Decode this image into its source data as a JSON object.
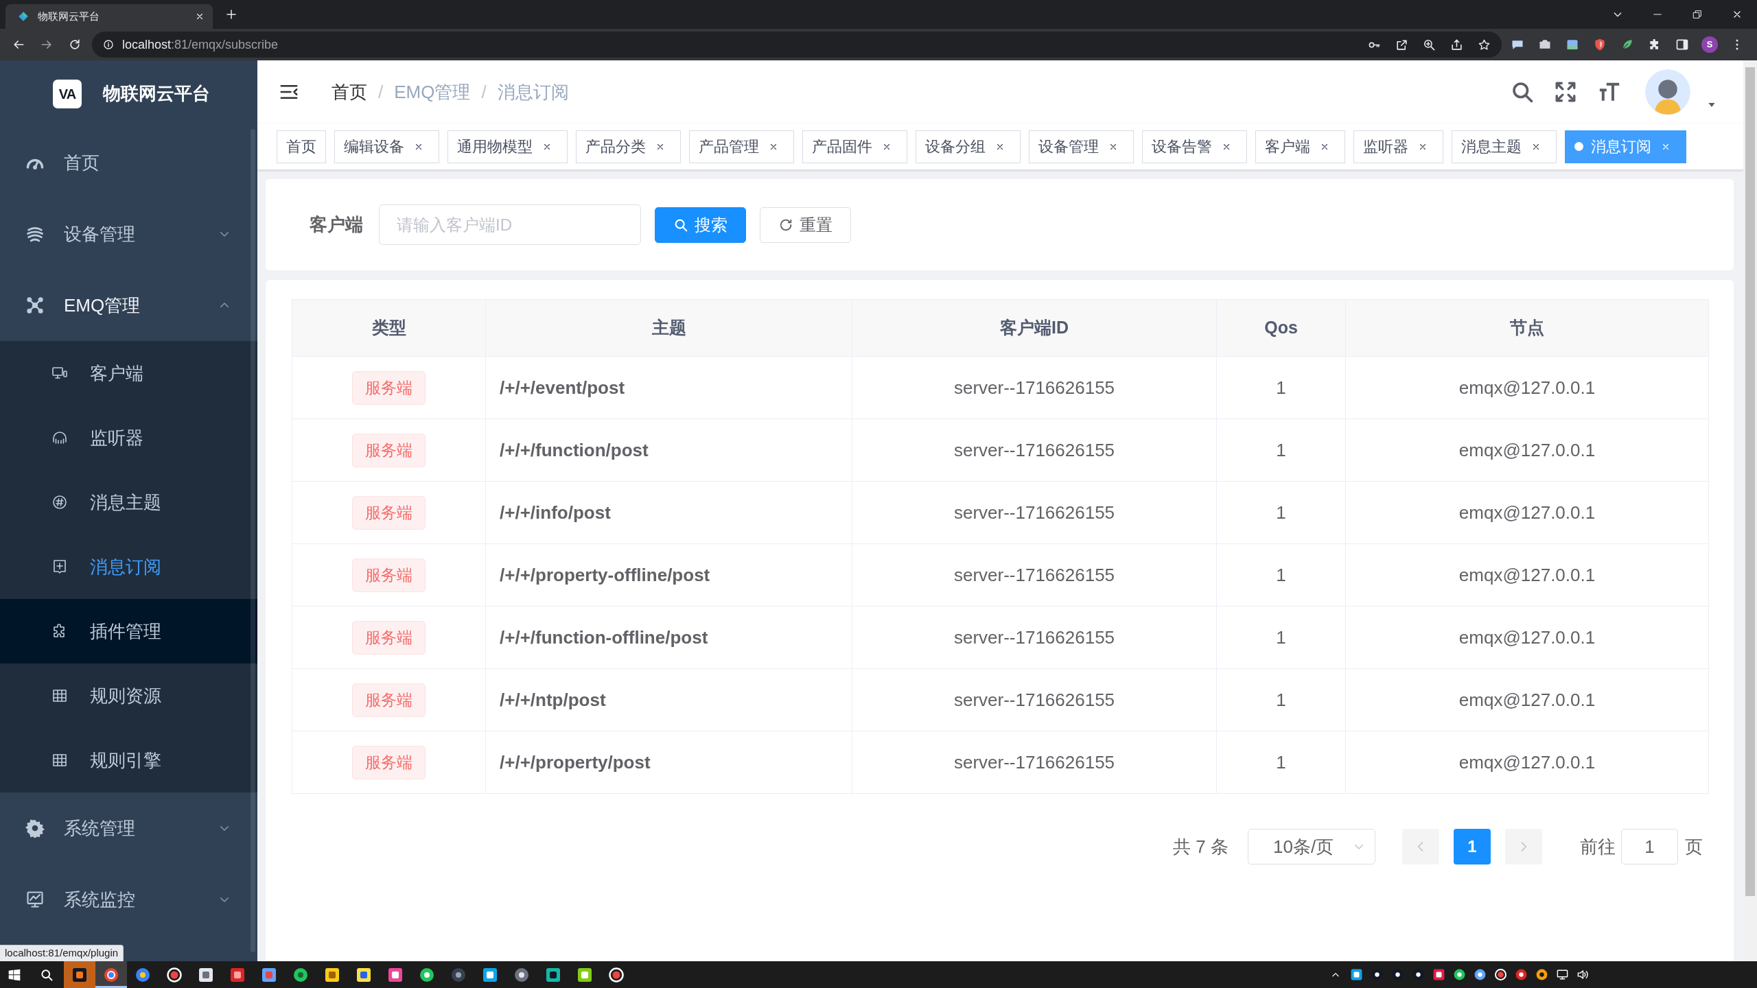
{
  "browser": {
    "tab_title": "物联网云平台",
    "url": {
      "host": "localhost",
      "rest": ":81/emqx/subscribe"
    },
    "profile_initial": "S",
    "status_url": "localhost:81/emqx/plugin"
  },
  "sidebar": {
    "logo_mark": "VA",
    "title": "物联网云平台",
    "items": [
      {
        "label": "首页",
        "kind": "link",
        "selected": false
      },
      {
        "label": "设备管理",
        "kind": "submenu",
        "selected": false,
        "expanded": false
      },
      {
        "label": "EMQ管理",
        "kind": "submenu",
        "selected": false,
        "expanded": true,
        "children": [
          {
            "label": "客户端",
            "selected": false,
            "hovered": false
          },
          {
            "label": "监听器",
            "selected": false,
            "hovered": false
          },
          {
            "label": "消息主题",
            "selected": false,
            "hovered": false
          },
          {
            "label": "消息订阅",
            "selected": true,
            "hovered": false
          },
          {
            "label": "插件管理",
            "selected": false,
            "hovered": true
          },
          {
            "label": "规则资源",
            "selected": false,
            "hovered": false
          },
          {
            "label": "规则引擎",
            "selected": false,
            "hovered": false
          }
        ]
      },
      {
        "label": "系统管理",
        "kind": "submenu",
        "selected": false,
        "expanded": false
      },
      {
        "label": "系统监控",
        "kind": "submenu",
        "selected": false,
        "expanded": false
      }
    ]
  },
  "navbar": {
    "breadcrumb": [
      {
        "label": "首页",
        "link": true
      },
      {
        "separator": "/",
        "label": "EMQ管理",
        "link": false
      },
      {
        "separator": "/",
        "label": "消息订阅",
        "link": false
      }
    ]
  },
  "tags": [
    {
      "label": "首页",
      "closable": false,
      "selected": false
    },
    {
      "label": "编辑设备",
      "closable": true,
      "selected": false
    },
    {
      "label": "通用物模型",
      "closable": true,
      "selected": false
    },
    {
      "label": "产品分类",
      "closable": true,
      "selected": false
    },
    {
      "label": "产品管理",
      "closable": true,
      "selected": false
    },
    {
      "label": "产品固件",
      "closable": true,
      "selected": false
    },
    {
      "label": "设备分组",
      "closable": true,
      "selected": false
    },
    {
      "label": "设备管理",
      "closable": true,
      "selected": false
    },
    {
      "label": "设备告警",
      "closable": true,
      "selected": false
    },
    {
      "label": "客户端",
      "closable": true,
      "selected": false
    },
    {
      "label": "监听器",
      "closable": true,
      "selected": false
    },
    {
      "label": "消息主题",
      "closable": true,
      "selected": false
    },
    {
      "label": "消息订阅",
      "closable": true,
      "selected": true
    }
  ],
  "search": {
    "label": "客户端",
    "placeholder": "请输入客户端ID",
    "buttons": [
      {
        "label": "搜索",
        "kind": "primary"
      },
      {
        "label": "重置",
        "kind": "default"
      }
    ]
  },
  "table": {
    "columns": [
      "类型",
      "主题",
      "客户端ID",
      "Qos",
      "节点"
    ],
    "rows": [
      {
        "type": "服务端",
        "topic": "/+/+/event/post",
        "client_id": "server--1716626155",
        "qos": "1",
        "node": "emqx@127.0.0.1"
      },
      {
        "type": "服务端",
        "topic": "/+/+/function/post",
        "client_id": "server--1716626155",
        "qos": "1",
        "node": "emqx@127.0.0.1"
      },
      {
        "type": "服务端",
        "topic": "/+/+/info/post",
        "client_id": "server--1716626155",
        "qos": "1",
        "node": "emqx@127.0.0.1"
      },
      {
        "type": "服务端",
        "topic": "/+/+/property-offline/post",
        "client_id": "server--1716626155",
        "qos": "1",
        "node": "emqx@127.0.0.1"
      },
      {
        "type": "服务端",
        "topic": "/+/+/function-offline/post",
        "client_id": "server--1716626155",
        "qos": "1",
        "node": "emqx@127.0.0.1"
      },
      {
        "type": "服务端",
        "topic": "/+/+/ntp/post",
        "client_id": "server--1716626155",
        "qos": "1",
        "node": "emqx@127.0.0.1"
      },
      {
        "type": "服务端",
        "topic": "/+/+/property/post",
        "client_id": "server--1716626155",
        "qos": "1",
        "node": "emqx@127.0.0.1"
      }
    ]
  },
  "pagination": {
    "total": "共 7 条",
    "page_size": "10条/页",
    "prev_disabled": true,
    "pages": [
      {
        "label": "1",
        "selected": true
      }
    ],
    "next_disabled": true,
    "goto_label": "前往",
    "goto_value": "1",
    "goto_suffix": "页"
  },
  "taskbar": {
    "apps": [
      {
        "selected": false,
        "attention": true
      },
      {
        "selected": true,
        "attention": false
      },
      {
        "selected": false,
        "attention": false
      },
      {
        "selected": false,
        "attention": false
      },
      {
        "selected": false,
        "attention": false
      },
      {
        "selected": false,
        "attention": false
      },
      {
        "selected": false,
        "attention": false
      },
      {
        "selected": false,
        "attention": false
      },
      {
        "selected": false,
        "attention": false
      },
      {
        "selected": false,
        "attention": false
      },
      {
        "selected": false,
        "attention": false
      },
      {
        "selected": false,
        "attention": false
      },
      {
        "selected": false,
        "attention": false
      },
      {
        "selected": false,
        "attention": false
      },
      {
        "selected": false,
        "attention": false
      },
      {
        "selected": false,
        "attention": false
      },
      {
        "selected": false,
        "attention": false
      },
      {
        "selected": false,
        "attention": false
      }
    ]
  }
}
